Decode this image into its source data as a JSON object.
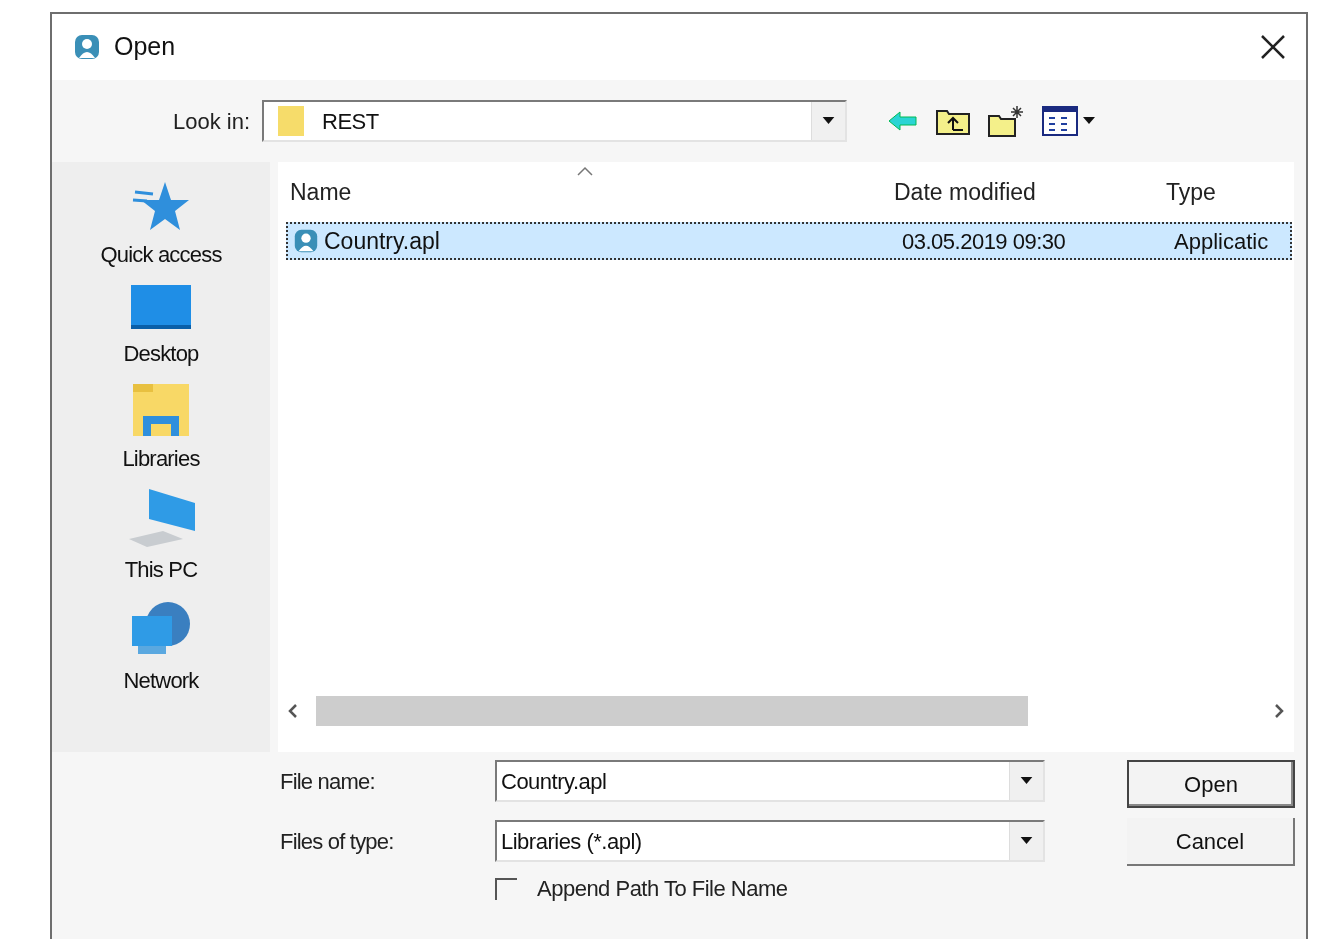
{
  "window": {
    "title": "Open"
  },
  "look_in": {
    "label": "Look in:",
    "value": "REST"
  },
  "places": [
    {
      "label": "Quick access",
      "kind": "star"
    },
    {
      "label": "Desktop",
      "kind": "desktop"
    },
    {
      "label": "Libraries",
      "kind": "libraries"
    },
    {
      "label": "This PC",
      "kind": "pc"
    },
    {
      "label": "Network",
      "kind": "network"
    }
  ],
  "file_list": {
    "columns": [
      "Name",
      "Date modified",
      "Type"
    ],
    "rows": [
      {
        "name": "Country.apl",
        "date": "03.05.2019 09:30",
        "type": "Applicatic",
        "selected": true
      }
    ]
  },
  "file_name": {
    "label": "File name:",
    "value": "Country.apl"
  },
  "file_type": {
    "label": "Files of type:",
    "value": "Libraries (*.apl)"
  },
  "append_path": {
    "label": "Append Path To File Name",
    "checked": false
  },
  "buttons": [
    {
      "label": "Open",
      "default": true
    },
    {
      "label": "Cancel",
      "default": false
    }
  ]
}
